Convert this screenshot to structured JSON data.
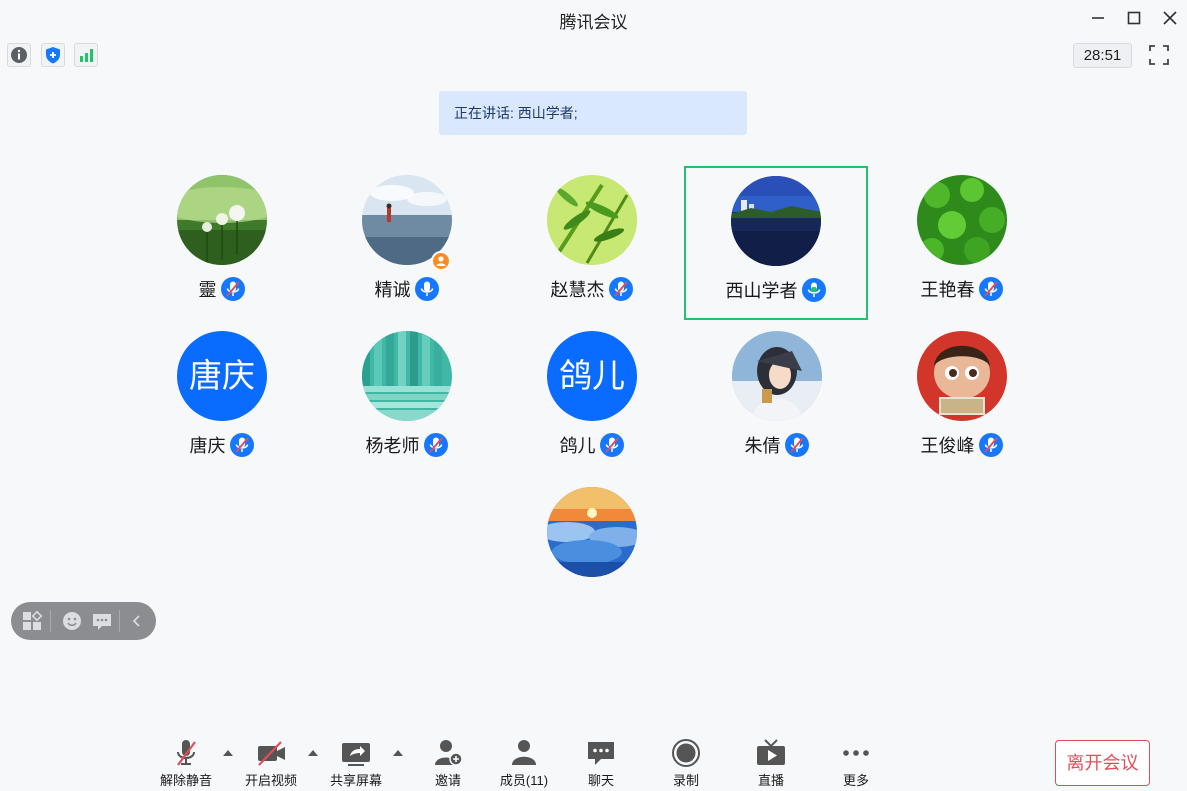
{
  "window": {
    "title": "腾讯会议"
  },
  "timer": "28:51",
  "speaking": "正在讲话: 西山学者;",
  "participants": [
    {
      "name": "靈",
      "avatar": "dandelion-photo",
      "mic": "muted"
    },
    {
      "name": "精诚",
      "avatar": "lake-person-photo",
      "mic": "on",
      "host_badge": true
    },
    {
      "name": "赵慧杰",
      "avatar": "bamboo-photo",
      "mic": "muted"
    },
    {
      "name": "西山学者",
      "avatar": "lake-skyline-photo",
      "mic": "speaking",
      "active": true
    },
    {
      "name": "王艳春",
      "avatar": "clover-photo",
      "mic": "muted"
    },
    {
      "name": "唐庆",
      "avatar_text": "唐庆",
      "mic": "muted"
    },
    {
      "name": "杨老师",
      "avatar": "teal-stripes-photo",
      "mic": "muted"
    },
    {
      "name": "鸽儿",
      "avatar_text": "鸽儿",
      "mic": "muted"
    },
    {
      "name": "朱倩",
      "avatar": "anime-girl-photo",
      "mic": "muted"
    },
    {
      "name": "王俊峰",
      "avatar": "cartoon-child-photo",
      "mic": "muted"
    },
    {
      "name": "",
      "avatar": "sunrise-clouds-photo"
    }
  ],
  "toolbar": {
    "unmute": "解除静音",
    "video": "开启视频",
    "share": "共享屏幕",
    "invite": "邀请",
    "members": "成员(11)",
    "chat": "聊天",
    "record": "录制",
    "live": "直播",
    "more": "更多",
    "leave": "离开会议"
  },
  "colors": {
    "accent": "#0a6cff",
    "speaking_border": "#22c16b",
    "leave": "#e34d59",
    "muted_slash": "#e34d59"
  }
}
